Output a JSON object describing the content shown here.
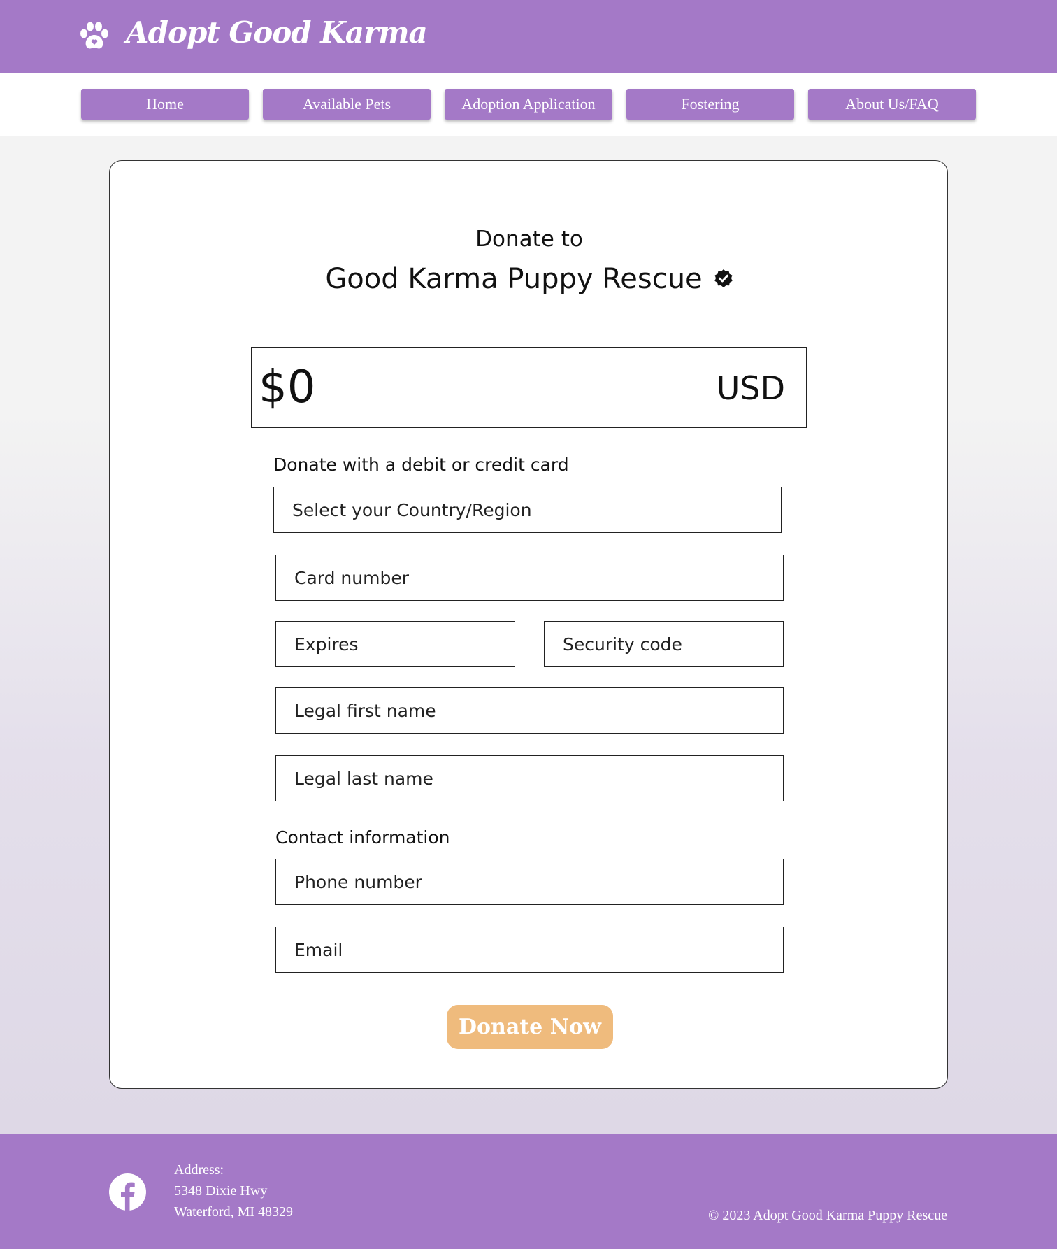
{
  "header": {
    "logo_icon": "paw-icon",
    "brand": "Adopt Good Karma",
    "brand_color": "#a479c7"
  },
  "nav": {
    "items": [
      {
        "label": "Home"
      },
      {
        "label": "Available Pets"
      },
      {
        "label": "Adoption Application"
      },
      {
        "label": "Fostering"
      },
      {
        "label": "About Us/FAQ"
      }
    ]
  },
  "donation": {
    "heading": "Donate to",
    "organization": "Good Karma Puppy Rescue",
    "verified_icon": "verified-badge-icon",
    "amount": "$0",
    "currency": "USD",
    "card_section_label": "Donate with a debit or credit card",
    "fields": {
      "country": "Select your Country/Region",
      "card_number": "Card number",
      "expires": "Expires",
      "security_code": "Security code",
      "first_name": "Legal first name",
      "last_name": "Legal last name",
      "phone": "Phone number",
      "email": "Email"
    },
    "contact_section_label": "Contact information",
    "submit_label": "Donate Now",
    "submit_color": "#efbb7d"
  },
  "footer": {
    "social_icon": "facebook-icon",
    "address_label": "Address:",
    "address_line1": "5348 Dixie Hwy",
    "address_line2": "Waterford, MI 48329",
    "copyright": "© 2023 Adopt Good Karma Puppy Rescue"
  }
}
